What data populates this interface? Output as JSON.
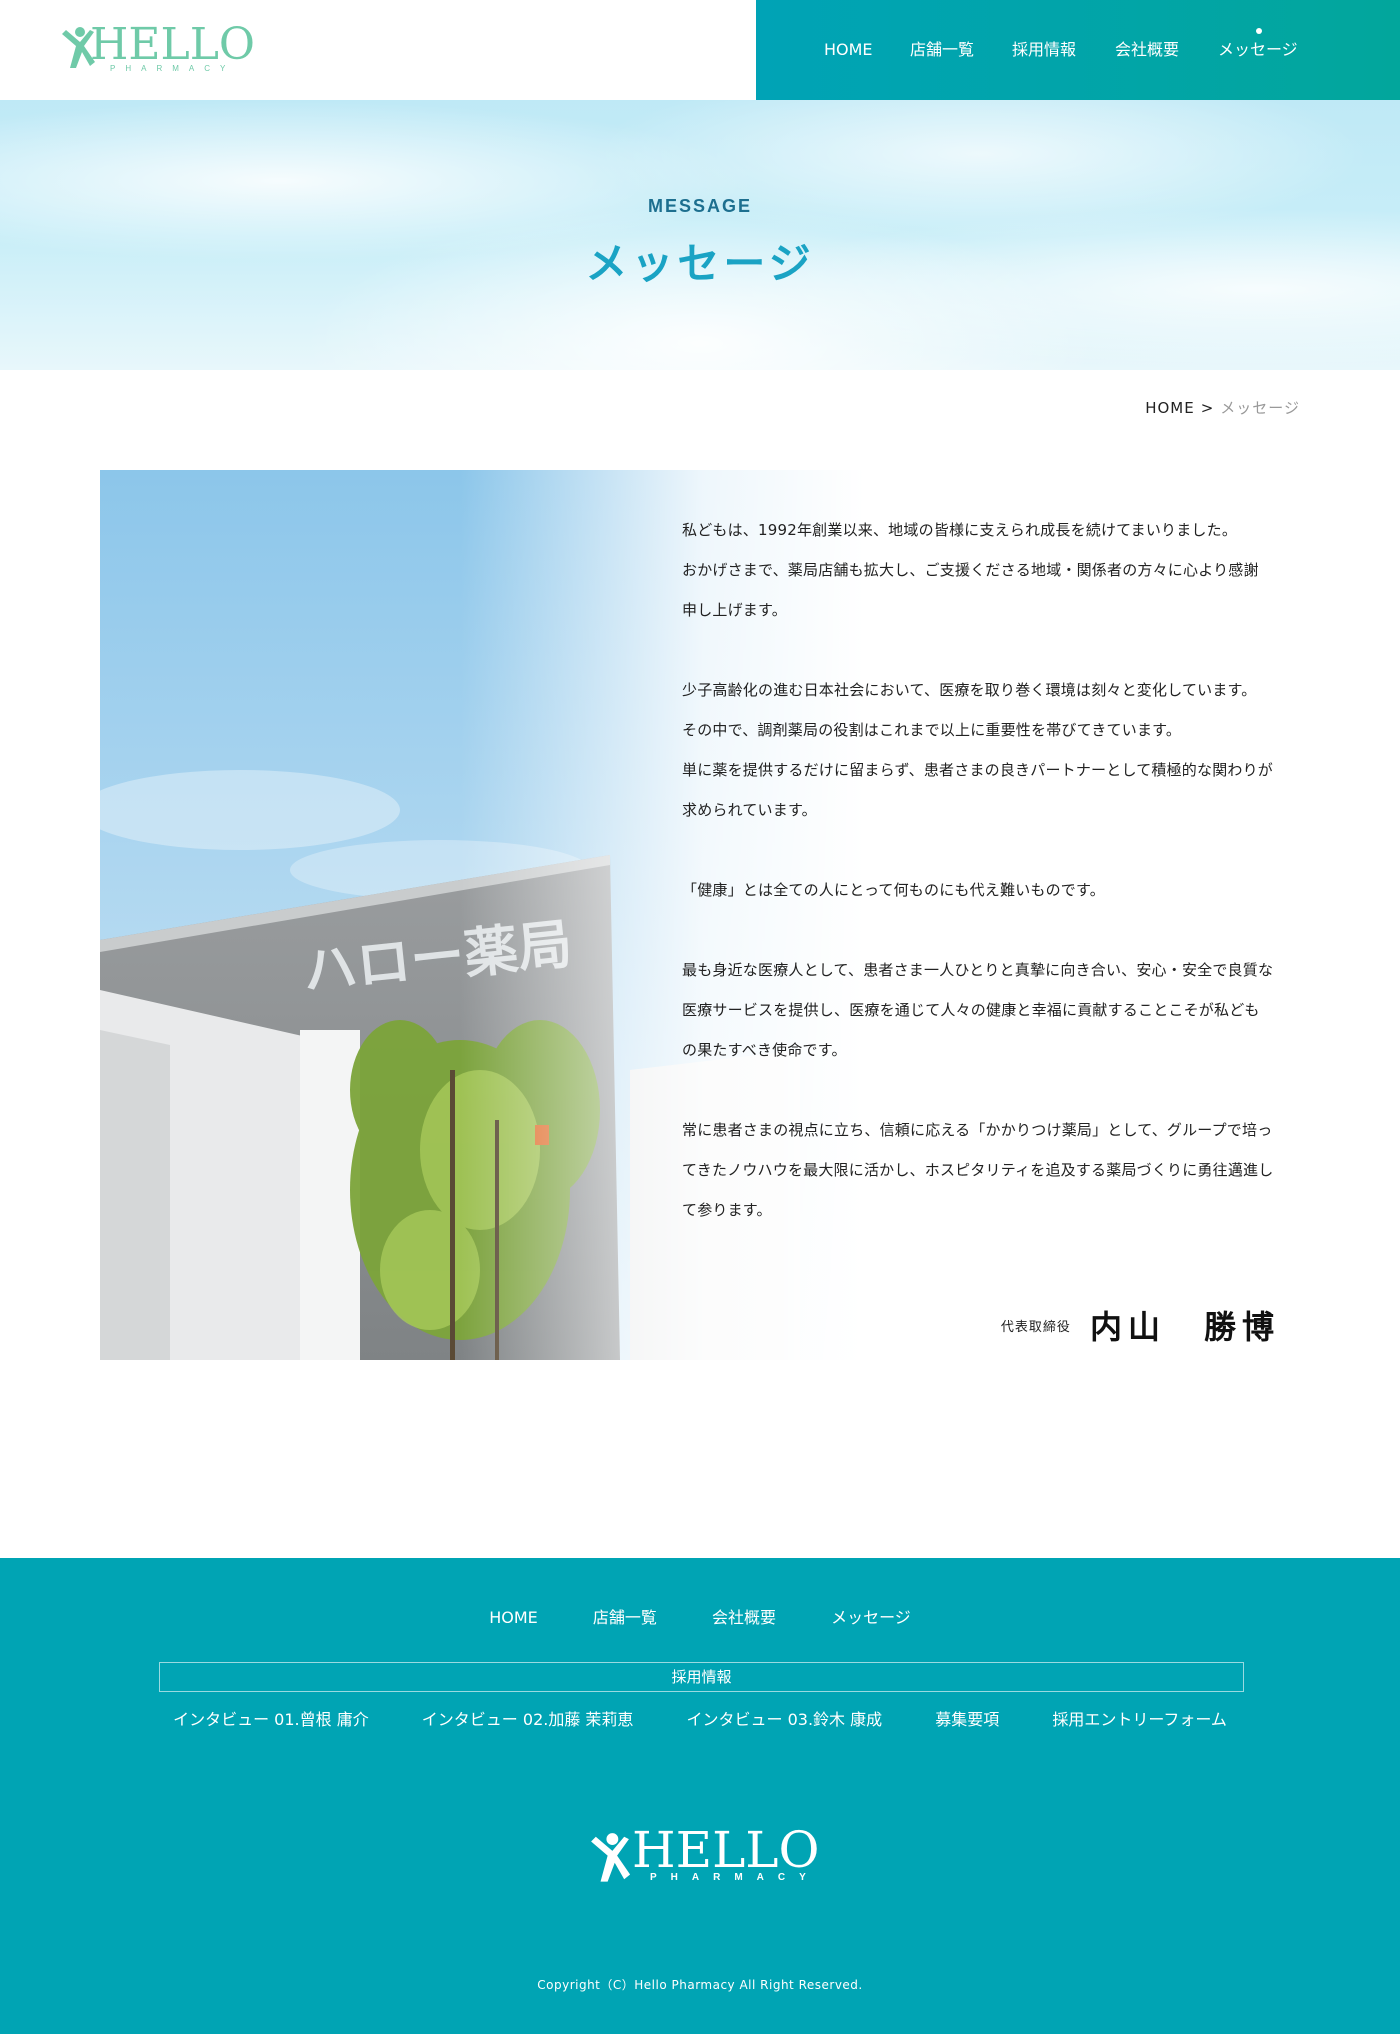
{
  "header": {
    "logo_text": "HELLO",
    "logo_sub": "PHARMACY",
    "nav": [
      "HOME",
      "店舗一覧",
      "採用情報",
      "会社概要",
      "メッセージ"
    ]
  },
  "hero": {
    "subtitle": "MESSAGE",
    "title": "メッセージ"
  },
  "breadcrumb": {
    "home": "HOME",
    "separator": ">",
    "current": "メッセージ"
  },
  "photo": {
    "sign_text": "ハロー薬局"
  },
  "message": {
    "paragraphs": [
      "私どもは、1992年創業以来、地域の皆様に支えられ成長を続けてまいりました。\nおかげさまで、薬局店舗も拡大し、ご支援くださる地域・関係者の方々に心より感謝\n申し上げます。",
      "少子高齢化の進む日本社会において、医療を取り巻く環境は刻々と変化しています。\nその中で、調剤薬局の役割はこれまで以上に重要性を帯びてきています。\n単に薬を提供するだけに留まらず、患者さまの良きパートナーとして積極的な関わりが\n求められています。",
      "「健康」とは全ての人にとって何ものにも代え難いものです。",
      "最も身近な医療人として、患者さま一人ひとりと真摯に向き合い、安心・安全で良質な\n医療サービスを提供し、医療を通じて人々の健康と幸福に貢献することこそが私ども\nの果たすべき使命です。",
      "常に患者さまの視点に立ち、信頼に応える「かかりつけ薬局」として、グループで培っ\nてきたノウハウを最大限に活かし、ホスピタリティを追及する薬局づくりに勇往邁進し\nて参ります。"
    ],
    "signature_title": "代表取締役",
    "signature_name": "内山　勝博"
  },
  "footer": {
    "nav": [
      "HOME",
      "店舗一覧",
      "会社概要",
      "メッセージ"
    ],
    "recruit_label": "採用情報",
    "recruit_links": [
      "インタビュー 01.曾根 庸介",
      "インタビュー 02.加藤 茉莉恵",
      "インタビュー 03.鈴木 康成",
      "募集要項",
      "採用エントリーフォーム"
    ],
    "logo_text": "HELLO",
    "logo_sub": "PHARMACY",
    "copyright": "Copyright（C）Hello Pharmacy All Right Reserved."
  },
  "colors": {
    "nav_bg": "#00a3b6",
    "accent": "#1aa3c4",
    "footer_bg": "#00a4b4",
    "logo": "#6fcaa8"
  }
}
